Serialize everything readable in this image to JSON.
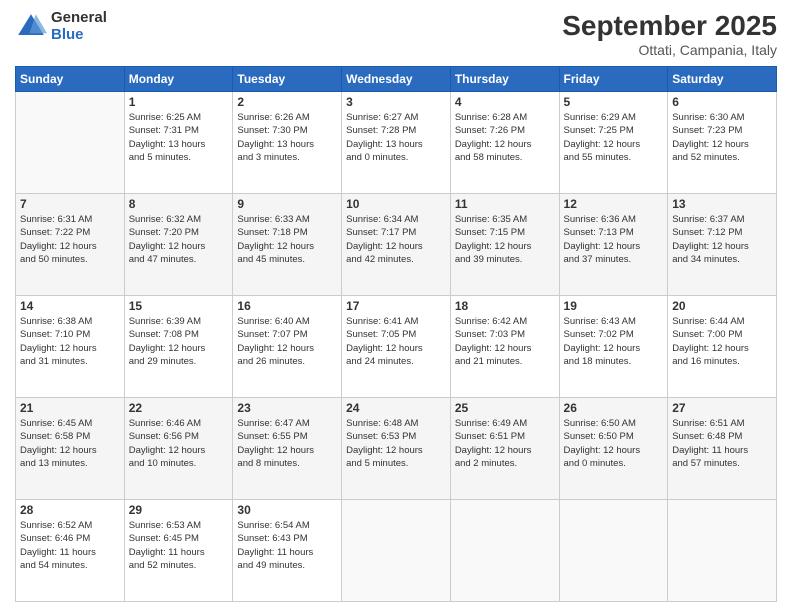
{
  "logo": {
    "general": "General",
    "blue": "Blue"
  },
  "header": {
    "month": "September 2025",
    "location": "Ottati, Campania, Italy"
  },
  "weekdays": [
    "Sunday",
    "Monday",
    "Tuesday",
    "Wednesday",
    "Thursday",
    "Friday",
    "Saturday"
  ],
  "weeks": [
    [
      {
        "day": "",
        "info": ""
      },
      {
        "day": "1",
        "info": "Sunrise: 6:25 AM\nSunset: 7:31 PM\nDaylight: 13 hours\nand 5 minutes."
      },
      {
        "day": "2",
        "info": "Sunrise: 6:26 AM\nSunset: 7:30 PM\nDaylight: 13 hours\nand 3 minutes."
      },
      {
        "day": "3",
        "info": "Sunrise: 6:27 AM\nSunset: 7:28 PM\nDaylight: 13 hours\nand 0 minutes."
      },
      {
        "day": "4",
        "info": "Sunrise: 6:28 AM\nSunset: 7:26 PM\nDaylight: 12 hours\nand 58 minutes."
      },
      {
        "day": "5",
        "info": "Sunrise: 6:29 AM\nSunset: 7:25 PM\nDaylight: 12 hours\nand 55 minutes."
      },
      {
        "day": "6",
        "info": "Sunrise: 6:30 AM\nSunset: 7:23 PM\nDaylight: 12 hours\nand 52 minutes."
      }
    ],
    [
      {
        "day": "7",
        "info": "Sunrise: 6:31 AM\nSunset: 7:22 PM\nDaylight: 12 hours\nand 50 minutes."
      },
      {
        "day": "8",
        "info": "Sunrise: 6:32 AM\nSunset: 7:20 PM\nDaylight: 12 hours\nand 47 minutes."
      },
      {
        "day": "9",
        "info": "Sunrise: 6:33 AM\nSunset: 7:18 PM\nDaylight: 12 hours\nand 45 minutes."
      },
      {
        "day": "10",
        "info": "Sunrise: 6:34 AM\nSunset: 7:17 PM\nDaylight: 12 hours\nand 42 minutes."
      },
      {
        "day": "11",
        "info": "Sunrise: 6:35 AM\nSunset: 7:15 PM\nDaylight: 12 hours\nand 39 minutes."
      },
      {
        "day": "12",
        "info": "Sunrise: 6:36 AM\nSunset: 7:13 PM\nDaylight: 12 hours\nand 37 minutes."
      },
      {
        "day": "13",
        "info": "Sunrise: 6:37 AM\nSunset: 7:12 PM\nDaylight: 12 hours\nand 34 minutes."
      }
    ],
    [
      {
        "day": "14",
        "info": "Sunrise: 6:38 AM\nSunset: 7:10 PM\nDaylight: 12 hours\nand 31 minutes."
      },
      {
        "day": "15",
        "info": "Sunrise: 6:39 AM\nSunset: 7:08 PM\nDaylight: 12 hours\nand 29 minutes."
      },
      {
        "day": "16",
        "info": "Sunrise: 6:40 AM\nSunset: 7:07 PM\nDaylight: 12 hours\nand 26 minutes."
      },
      {
        "day": "17",
        "info": "Sunrise: 6:41 AM\nSunset: 7:05 PM\nDaylight: 12 hours\nand 24 minutes."
      },
      {
        "day": "18",
        "info": "Sunrise: 6:42 AM\nSunset: 7:03 PM\nDaylight: 12 hours\nand 21 minutes."
      },
      {
        "day": "19",
        "info": "Sunrise: 6:43 AM\nSunset: 7:02 PM\nDaylight: 12 hours\nand 18 minutes."
      },
      {
        "day": "20",
        "info": "Sunrise: 6:44 AM\nSunset: 7:00 PM\nDaylight: 12 hours\nand 16 minutes."
      }
    ],
    [
      {
        "day": "21",
        "info": "Sunrise: 6:45 AM\nSunset: 6:58 PM\nDaylight: 12 hours\nand 13 minutes."
      },
      {
        "day": "22",
        "info": "Sunrise: 6:46 AM\nSunset: 6:56 PM\nDaylight: 12 hours\nand 10 minutes."
      },
      {
        "day": "23",
        "info": "Sunrise: 6:47 AM\nSunset: 6:55 PM\nDaylight: 12 hours\nand 8 minutes."
      },
      {
        "day": "24",
        "info": "Sunrise: 6:48 AM\nSunset: 6:53 PM\nDaylight: 12 hours\nand 5 minutes."
      },
      {
        "day": "25",
        "info": "Sunrise: 6:49 AM\nSunset: 6:51 PM\nDaylight: 12 hours\nand 2 minutes."
      },
      {
        "day": "26",
        "info": "Sunrise: 6:50 AM\nSunset: 6:50 PM\nDaylight: 12 hours\nand 0 minutes."
      },
      {
        "day": "27",
        "info": "Sunrise: 6:51 AM\nSunset: 6:48 PM\nDaylight: 11 hours\nand 57 minutes."
      }
    ],
    [
      {
        "day": "28",
        "info": "Sunrise: 6:52 AM\nSunset: 6:46 PM\nDaylight: 11 hours\nand 54 minutes."
      },
      {
        "day": "29",
        "info": "Sunrise: 6:53 AM\nSunset: 6:45 PM\nDaylight: 11 hours\nand 52 minutes."
      },
      {
        "day": "30",
        "info": "Sunrise: 6:54 AM\nSunset: 6:43 PM\nDaylight: 11 hours\nand 49 minutes."
      },
      {
        "day": "",
        "info": ""
      },
      {
        "day": "",
        "info": ""
      },
      {
        "day": "",
        "info": ""
      },
      {
        "day": "",
        "info": ""
      }
    ]
  ]
}
